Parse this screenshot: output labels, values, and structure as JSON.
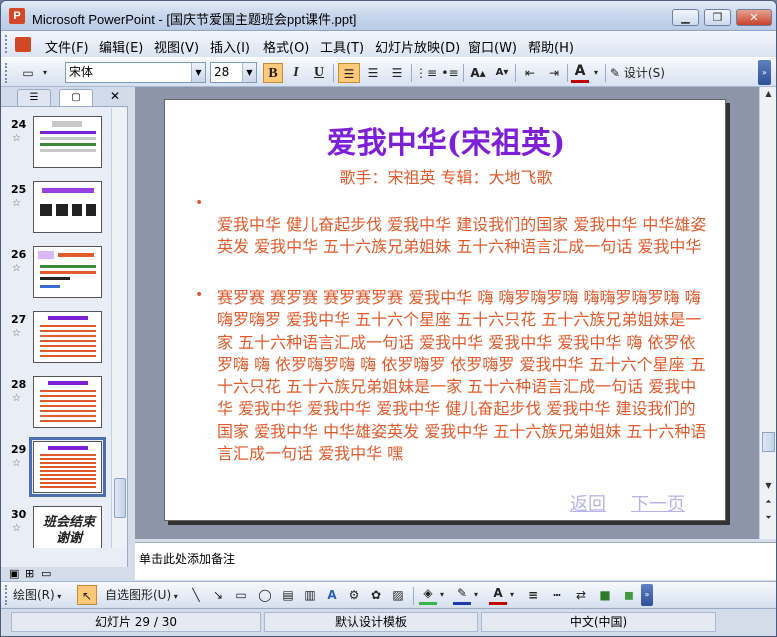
{
  "window": {
    "title": "Microsoft PowerPoint - [国庆节爱国主题班会ppt课件.ppt]",
    "app_icon": "P",
    "minimize_icon": "minimize-icon",
    "restore_icon": "restore-icon",
    "close_icon": "close-icon"
  },
  "menu": [
    {
      "label": "文件(F)"
    },
    {
      "label": "编辑(E)"
    },
    {
      "label": "视图(V)"
    },
    {
      "label": "插入(I)"
    },
    {
      "label": "格式(O)"
    },
    {
      "label": "工具(T)"
    },
    {
      "label": "幻灯片放映(D)"
    },
    {
      "label": "窗口(W)"
    },
    {
      "label": "帮助(H)"
    }
  ],
  "toolbar": {
    "font_name": "宋体",
    "font_size": "28",
    "bold": "B",
    "italic": "I",
    "underline": "U",
    "font_color": "A",
    "design_label": "设计(S)"
  },
  "thumbnails": [
    {
      "number": "24",
      "selected": false
    },
    {
      "number": "25",
      "selected": false
    },
    {
      "number": "26",
      "selected": false
    },
    {
      "number": "27",
      "selected": false
    },
    {
      "number": "28",
      "selected": false
    },
    {
      "number": "29",
      "selected": true
    },
    {
      "number": "30",
      "selected": false
    }
  ],
  "thumb30_text": "班会结束 谢谢",
  "slide": {
    "title": "爱我中华(宋祖英)",
    "subtitle": "歌手：宋祖英    专辑：大地飞歌",
    "bullet": "•",
    "paragraph1": "爱我中华 健儿奋起步伐 爱我中华 建设我们的国家 爱我中华 中华雄姿英发 爱我中华 五十六族兄弟姐妹 五十六种语言汇成一句话 爱我中华",
    "paragraph2": "赛罗赛 赛罗赛 赛罗赛罗赛 爱我中华 嗨 嗨罗嗨罗嗨 嗨嗨罗嗨罗嗨 嗨 嗨罗嗨罗 爱我中华 五十六个星座 五十六只花 五十六族兄弟姐妹是一家 五十六种语言汇成一句话 爱我中华 爱我中华 爱我中华 嗨 依罗依罗嗨 嗨 依罗嗨罗嗨 嗨 依罗嗨罗 依罗嗨罗 爱我中华 五十六个星座 五十六只花 五十六族兄弟姐妹是一家 五十六种语言汇成一句话 爱我中华 爱我中华 爱我中华 爱我中华 健儿奋起步伐 爱我中华 建设我们的国家 爱我中华 中华雄姿英发 爱我中华 五十六族兄弟姐妹 五十六种语言汇成一句话 爱我中华 嘿",
    "nav_back": "返回",
    "nav_next": "下一页",
    "title_color": "#7d1fd6",
    "text_color": "#e05a2b"
  },
  "notes": {
    "placeholder": "单击此处添加备注"
  },
  "drawbar": {
    "draw_label": "绘图(R)",
    "autoshape_label": "自选图形(U)"
  },
  "status": {
    "slide_pos": "幻灯片 29 / 30",
    "template": "默认设计模板",
    "language": "中文(中国)"
  }
}
